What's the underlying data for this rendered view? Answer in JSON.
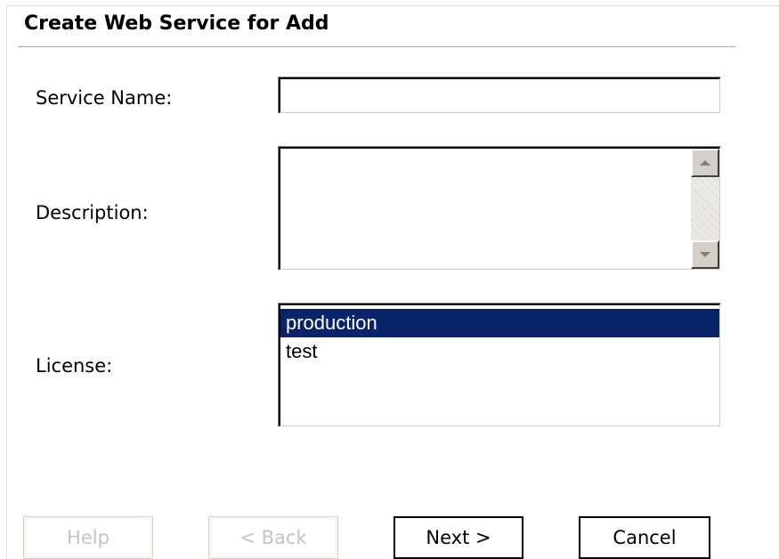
{
  "header": {
    "title": "Create Web Service for Add"
  },
  "form": {
    "service_name": {
      "label": "Service Name:",
      "value": ""
    },
    "description": {
      "label": "Description:",
      "value": ""
    },
    "license": {
      "label": "License:",
      "options": [
        "production",
        "test"
      ],
      "selected": "production"
    }
  },
  "buttons": {
    "help": "Help",
    "back": "< Back",
    "next": "Next >",
    "cancel": "Cancel"
  },
  "colors": {
    "selection_bg": "#0a246a",
    "selection_text": "#ffffff",
    "disabled_text": "#c6c3bd",
    "face": "#d4d0c8"
  },
  "icons": [
    "scroll-up-arrow-icon",
    "scroll-down-arrow-icon"
  ]
}
